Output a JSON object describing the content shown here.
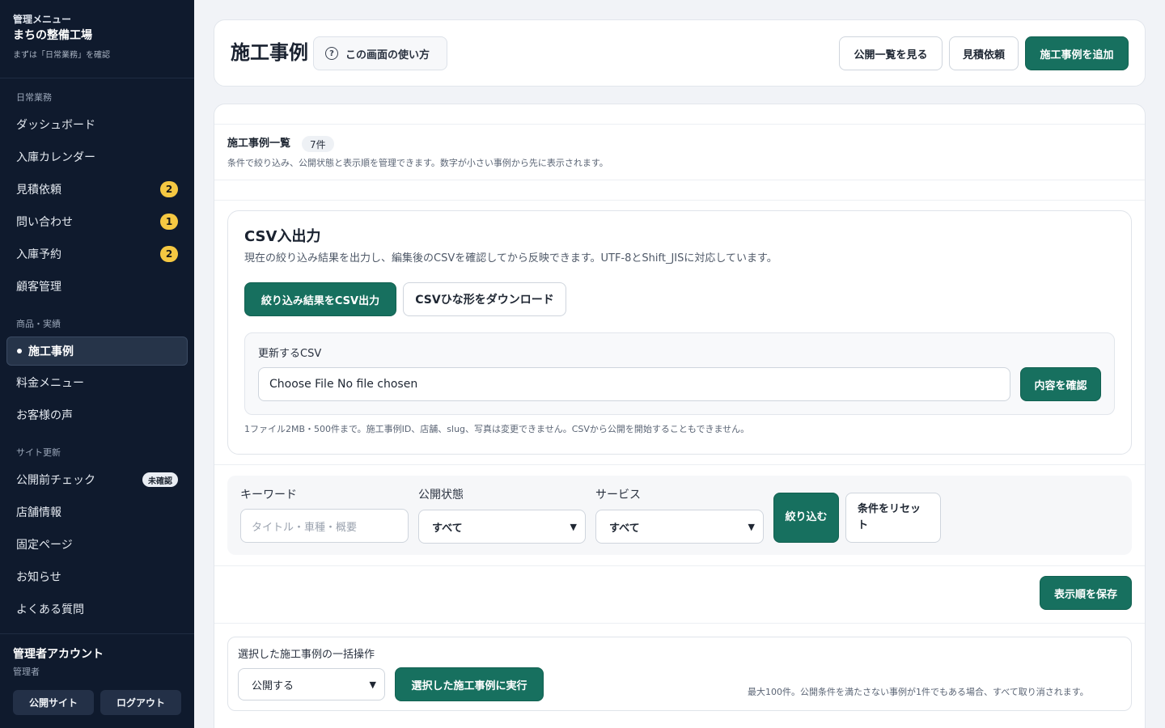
{
  "sidebar": {
    "kicker": "管理メニュー",
    "shop_name": "まちの整備工場",
    "hint": "まずは「日常業務」を確認",
    "sections": {
      "daily": "日常業務",
      "products": "商品・実績",
      "site": "サイト更新"
    },
    "items": {
      "dashboard": "ダッシュボード",
      "calendar": "入庫カレンダー",
      "estimates": "見積依頼",
      "estimates_count": "2",
      "inquiries": "問い合わせ",
      "inquiries_count": "1",
      "reservations": "入庫予約",
      "reservations_count": "2",
      "customers": "顧客管理",
      "cases": "施工事例",
      "pricing": "料金メニュー",
      "reviews": "お客様の声",
      "precheck": "公開前チェック",
      "precheck_badge": "未確認",
      "store": "店舗情報",
      "pages": "固定ページ",
      "news": "お知らせ",
      "faq": "よくある質問"
    },
    "account": {
      "name": "管理者アカウント",
      "role": "管理者",
      "public_site": "公開サイト",
      "logout": "ログアウト"
    }
  },
  "header": {
    "title": "施工事例",
    "help": "この画面の使い方",
    "view_public": "公開一覧を見る",
    "estimate": "見積依頼",
    "add_case": "施工事例を追加"
  },
  "list": {
    "title": "施工事例一覧",
    "count": "7件",
    "description": "条件で絞り込み、公開状態と表示順を管理できます。数字が小さい事例から先に表示されます。"
  },
  "csv": {
    "title": "CSV入出力",
    "description": "現在の絞り込み結果を出力し、編集後のCSVを確認してから反映できます。UTF-8とShift_JISに対応しています。",
    "export": "絞り込み結果をCSV出力",
    "template": "CSVひな形をダウンロード",
    "update_label": "更新するCSV",
    "file_text": "Choose File No file chosen",
    "confirm": "内容を確認",
    "note": "1ファイル2MB・500件まで。施工事例ID、店舗、slug、写真は変更できません。CSVから公開を開始することもできません。"
  },
  "filters": {
    "keyword_label": "キーワード",
    "keyword_placeholder": "タイトル・車種・概要",
    "status_label": "公開状態",
    "status_value": "すべて",
    "service_label": "サービス",
    "service_value": "すべて",
    "apply": "絞り込む",
    "reset": "条件をリセット"
  },
  "order": {
    "save": "表示順を保存"
  },
  "bulk": {
    "label": "選択した施工事例の一括操作",
    "action_value": "公開する",
    "execute": "選択した施工事例に実行",
    "note": "最大100件。公開条件を満たさない事例が1件でもある場合、すべて取り消されます。"
  }
}
